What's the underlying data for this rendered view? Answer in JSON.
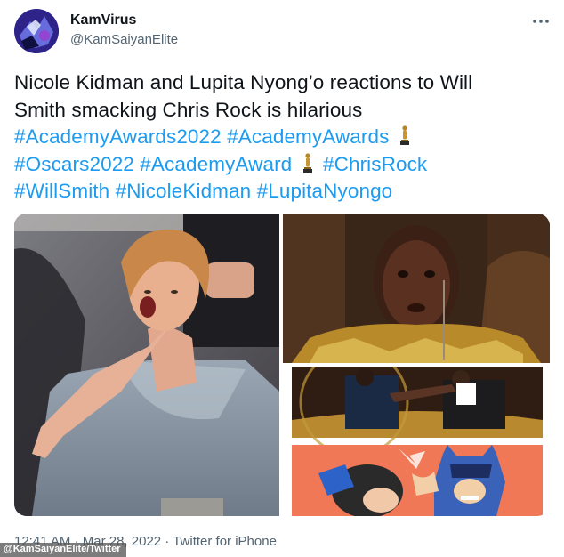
{
  "user": {
    "display_name": "KamVirus",
    "handle": "@KamSaiyanElite",
    "avatar_icon": "avatar-image"
  },
  "more_icon": "more-horizontal-icon",
  "tweet": {
    "line1_text": "Nicole Kidman and Lupita Nyong’o reactions to Will",
    "line2_text": "Smith smacking Chris Rock is hilarious",
    "hashtags": {
      "h1": "#AcademyAwards2022",
      "h2": "#AcademyAwards",
      "h3": "#Oscars2022",
      "h4": "#AcademyAward",
      "h5": "#ChrisRock",
      "h6": "#WillSmith",
      "h7": "#NicoleKidman",
      "h8": "#LupitaNyongo"
    },
    "emoji_icon": "oscar-trophy-icon"
  },
  "media": {
    "photos": [
      {
        "name": "nicole-kidman-photo"
      },
      {
        "name": "lupita-nyongo-photo"
      },
      {
        "name": "will-smith-slap-photo"
      },
      {
        "name": "batman-slap-comic-photo"
      }
    ]
  },
  "meta": {
    "time": "12:41 AM",
    "separator": "·",
    "date": "Mar 28, 2022",
    "source": "Twitter for iPhone"
  },
  "credit": "@KamSaiyanElite/Twitter",
  "colors": {
    "link": "#1d9bf0",
    "text": "#0f1419",
    "secondary": "#536471"
  }
}
